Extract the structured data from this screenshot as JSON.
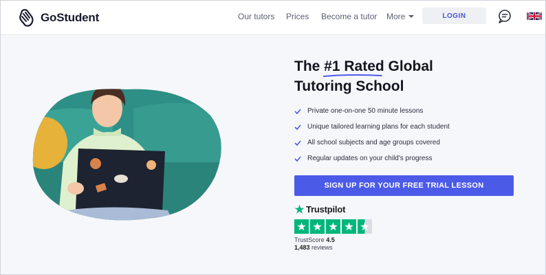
{
  "brand": {
    "name": "GoStudent",
    "logo_icon": "hand-logo-icon"
  },
  "nav": {
    "links": [
      "Our tutors",
      "Prices",
      "Become a tutor"
    ],
    "more_label": "More",
    "login_label": "LOGIN",
    "chat_icon": "chat-bubble-icon",
    "language_flag": "uk-flag-icon"
  },
  "hero": {
    "headline_prefix": "The ",
    "headline_highlight": "#1 Rated",
    "headline_mid": " Global",
    "headline_line2": "Tutoring School",
    "features": [
      "Private one-on-one 50 minute lessons",
      "Unique tailored learning plans for each student",
      "All school subjects and age groups covered",
      "Regular updates on your child's progress"
    ],
    "cta_label": "SIGN UP FOR YOUR FREE TRIAL LESSON"
  },
  "trustpilot": {
    "brand": "Trustpilot",
    "score_label": "TrustScore",
    "score_value": "4.5",
    "review_count": "1,483",
    "reviews_label": " reviews"
  },
  "colors": {
    "accent": "#4c5ae8",
    "trustpilot_green": "#00b67a",
    "background": "#f6f7fb"
  }
}
